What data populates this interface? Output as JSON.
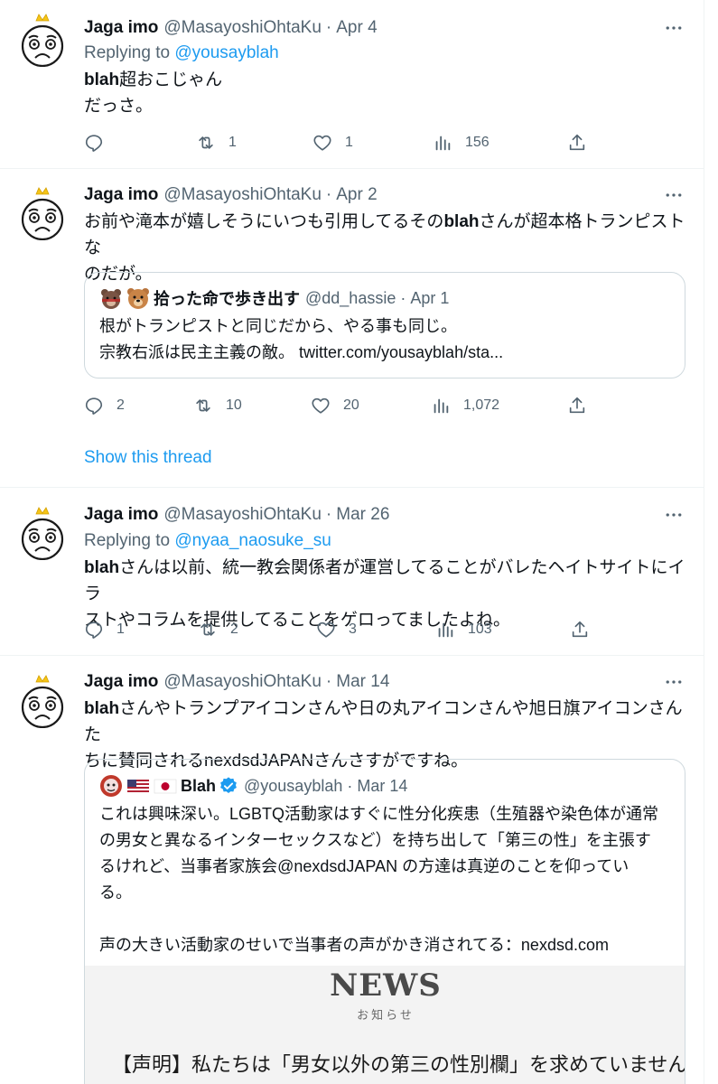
{
  "tweets": [
    {
      "name": "Jaga imo",
      "handle": "@MasayoshiOhtaKu",
      "sep": "·",
      "date": "Apr 4",
      "reply_prefix": "Replying to ",
      "reply_to": "@yousayblah",
      "body_bold": "blah",
      "body_lines": [
        "超おこじゃん",
        "だっさ。"
      ],
      "replies": "",
      "retweets": "1",
      "likes": "1",
      "views": "156"
    },
    {
      "name": "Jaga imo",
      "handle": "@MasayoshiOhtaKu",
      "sep": "·",
      "date": "Apr 2",
      "body_pre": "お前や滝本が嬉しそうにいつも引用してるその",
      "body_bold": "blah",
      "body_post": "さんが超本格トランピストな",
      "body_line2": "のだが。",
      "quote": {
        "name": "拾った命で歩き出す",
        "handle": "@dd_hassie",
        "sep": "·",
        "date": "Apr 1",
        "lines": [
          "根がトランピストと同じだから、やる事も同じ。",
          "宗教右派は民主主義の敵。 twitter.com/yousayblah/sta..."
        ]
      },
      "replies": "2",
      "retweets": "10",
      "likes": "20",
      "views": "1,072",
      "show_thread": "Show this thread"
    },
    {
      "name": "Jaga imo",
      "handle": "@MasayoshiOhtaKu",
      "sep": "·",
      "date": "Mar 26",
      "reply_prefix": "Replying to ",
      "reply_to": "@nyaa_naosuke_su",
      "body_bold": "blah",
      "body_post": "さんは以前、統一教会関係者が運営してることがバレたヘイトサイトにイラ",
      "body_line2": "ストやコラムを提供してることをゲロってましたよね。",
      "replies": "1",
      "retweets": "2",
      "likes": "3",
      "views": "103"
    },
    {
      "name": "Jaga imo",
      "handle": "@MasayoshiOhtaKu",
      "sep": "·",
      "date": "Mar 14",
      "body_bold": "blah",
      "body_post": "さんやトランプアイコンさんや日の丸アイコンさんや旭日旗アイコンさんた",
      "body_line2": "ちに賛同されるnexdsdJAPANさんさすがですね。",
      "quote": {
        "name": "Blah",
        "handle": "@yousayblah",
        "sep": "·",
        "date": "Mar 14",
        "lines": [
          "これは興味深い。LGBTQ活動家はすぐに性分化疾患（生殖器や染色体が通常",
          "の男女と異なるインターセックスなど）を持ち出して「第三の性」を主張す",
          "るけれど、当事者家族会@nexdsdJAPAN の方達は真逆のことを仰ってい",
          "る。",
          "",
          "声の大きい活動家のせいで当事者の声がかき消されてる：nexdsd.com"
        ],
        "news_title": "NEWS",
        "news_sub": "お知らせ",
        "news_headline": "【声明】私たちは「男女以外の第三の性別欄」を求めていません。"
      }
    }
  ],
  "colors": {
    "accent": "#1d9bf0",
    "muted": "#536471",
    "text": "#0f1419",
    "border": "#cfd9de",
    "verified": "#1d9bf0"
  }
}
